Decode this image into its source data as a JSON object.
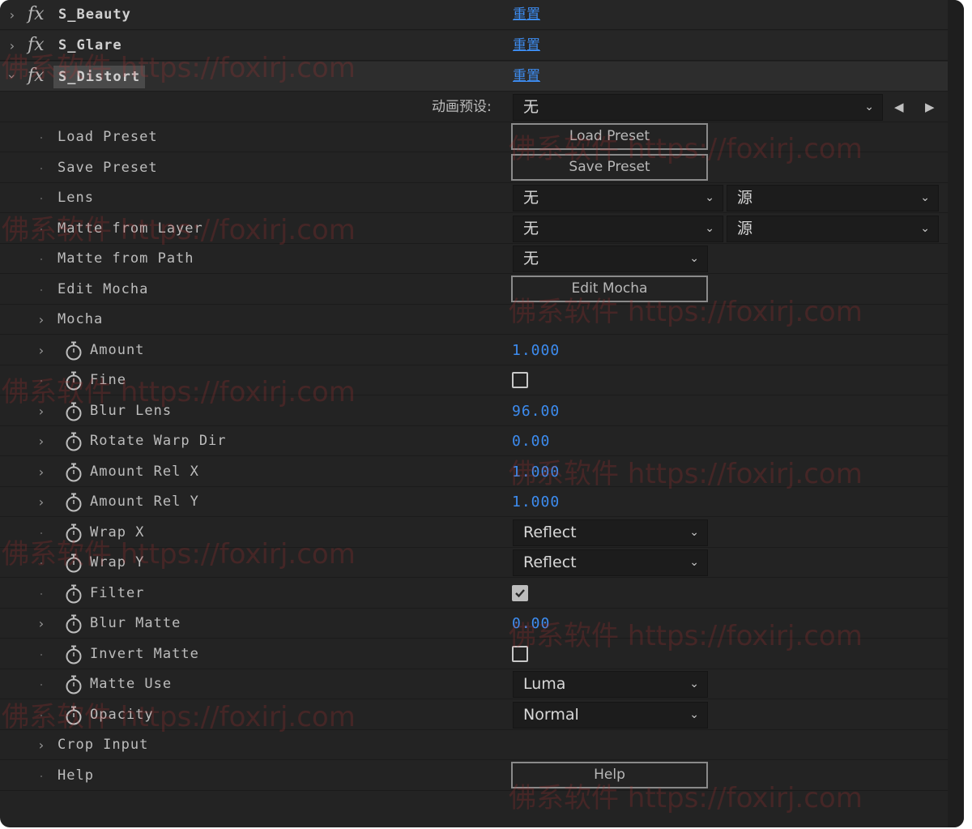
{
  "effects": [
    {
      "name": "S_Beauty",
      "reset": "重置",
      "expanded": false
    },
    {
      "name": "S_Glare",
      "reset": "重置",
      "expanded": false
    },
    {
      "name": "S_Distort",
      "reset": "重置",
      "expanded": true
    }
  ],
  "animation_preset": {
    "label": "动画预设:",
    "value": "无"
  },
  "params": {
    "load_preset": {
      "label": "Load Preset",
      "button": "Load Preset"
    },
    "save_preset": {
      "label": "Save Preset",
      "button": "Save Preset"
    },
    "lens": {
      "label": "Lens",
      "layer": "无",
      "source": "源"
    },
    "matte_from_layer": {
      "label": "Matte from Layer",
      "layer": "无",
      "source": "源"
    },
    "matte_from_path": {
      "label": "Matte from Path",
      "value": "无"
    },
    "edit_mocha": {
      "label": "Edit Mocha",
      "button": "Edit Mocha"
    },
    "mocha": {
      "label": "Mocha"
    },
    "amount": {
      "label": "Amount",
      "value": "1.000"
    },
    "fine": {
      "label": "Fine",
      "checked": false
    },
    "blur_lens": {
      "label": "Blur Lens",
      "value": "96.00"
    },
    "rotate_warp_dir": {
      "label": "Rotate Warp Dir",
      "value": "0.00"
    },
    "amount_rel_x": {
      "label": "Amount Rel X",
      "value": "1.000"
    },
    "amount_rel_y": {
      "label": "Amount Rel Y",
      "value": "1.000"
    },
    "wrap_x": {
      "label": "Wrap X",
      "value": "Reflect"
    },
    "wrap_y": {
      "label": "Wrap Y",
      "value": "Reflect"
    },
    "filter": {
      "label": "Filter",
      "checked": true
    },
    "blur_matte": {
      "label": "Blur Matte",
      "value": "0.00"
    },
    "invert_matte": {
      "label": "Invert Matte",
      "checked": false
    },
    "matte_use": {
      "label": "Matte Use",
      "value": "Luma"
    },
    "opacity": {
      "label": "Opacity",
      "value": "Normal"
    },
    "crop_input": {
      "label": "Crop Input"
    },
    "help": {
      "label": "Help",
      "button": "Help"
    }
  },
  "watermark": "佛系软件 https://foxirj.com",
  "colors": {
    "panel": "#232323",
    "value_blue": "#3d8cf0",
    "label": "#bdbdbd"
  }
}
